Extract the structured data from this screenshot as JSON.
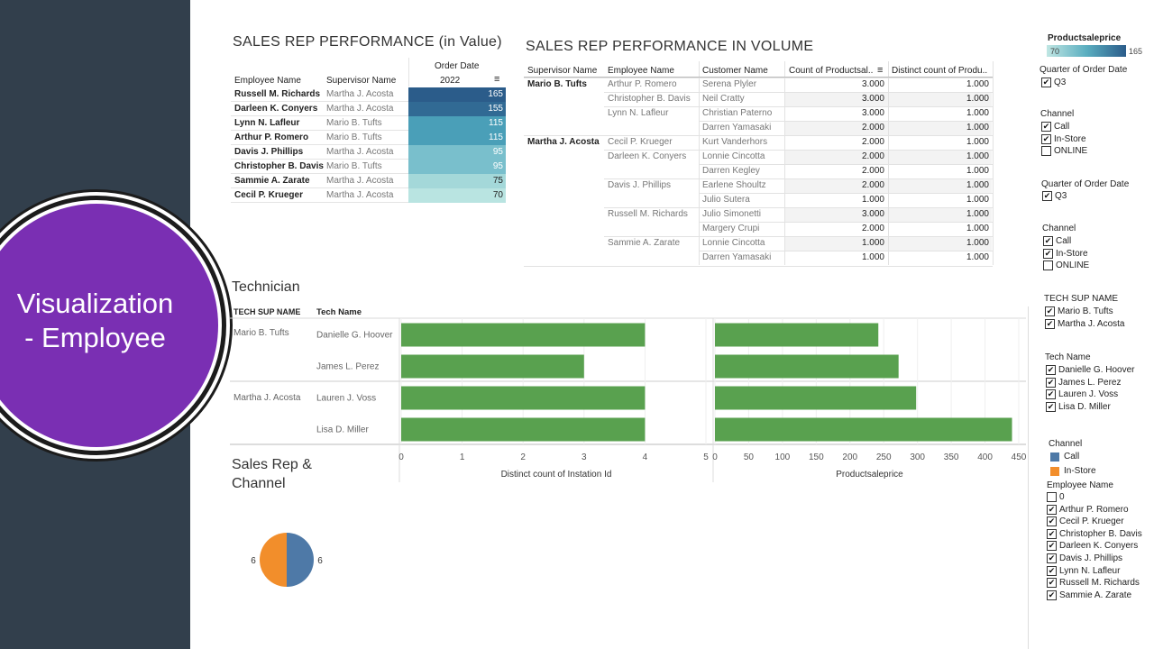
{
  "slide_title": "Visualization\n- Employee",
  "rep_value": {
    "title": "SALES REP PERFORMANCE (in Value)",
    "col_employee": "Employee Name",
    "col_supervisor": "Supervisor Name",
    "col_order_date": "Order Date",
    "col_year": "2022",
    "rows": [
      {
        "employee": "Russell M. Richards",
        "supervisor": "Martha J. Acosta",
        "value": "165",
        "color": "#2b5c8a",
        "text_color": "#ffffff"
      },
      {
        "employee": "Darleen K. Conyers",
        "supervisor": "Martha J. Acosta",
        "value": "155",
        "color": "#316a94",
        "text_color": "#ffffff"
      },
      {
        "employee": "Lynn N. Lafleur",
        "supervisor": "Mario B. Tufts",
        "value": "115",
        "color": "#4a9fb8",
        "text_color": "#ffffff"
      },
      {
        "employee": "Arthur P. Romero",
        "supervisor": "Mario B. Tufts",
        "value": "115",
        "color": "#4a9fb8",
        "text_color": "#ffffff"
      },
      {
        "employee": "Davis J. Phillips",
        "supervisor": "Martha J. Acosta",
        "value": "95",
        "color": "#79bfcc",
        "text_color": "#ffffff"
      },
      {
        "employee": "Christopher B. Davis",
        "supervisor": "Mario B. Tufts",
        "value": "95",
        "color": "#79bfcc",
        "text_color": "#ffffff"
      },
      {
        "employee": "Sammie A. Zarate",
        "supervisor": "Martha J. Acosta",
        "value": "75",
        "color": "#a4d8d9",
        "text_color": "#222222"
      },
      {
        "employee": "Cecil P. Krueger",
        "supervisor": "Martha J. Acosta",
        "value": "70",
        "color": "#b9e4e1",
        "text_color": "#222222"
      }
    ]
  },
  "rep_volume": {
    "title": "SALES REP PERFORMANCE IN VOLUME",
    "col_supervisor": "Supervisor Name",
    "col_employee": "Employee Name",
    "col_customer": "Customer Name",
    "col_count": "Count of Productsal..",
    "col_distinct": "Distinct count of Produ..",
    "rows": [
      {
        "supervisor": "Mario B. Tufts",
        "employee": "Arthur P. Romero",
        "customer": "Serena Plyler",
        "count": "3.000",
        "distinct": "1.000"
      },
      {
        "supervisor": "",
        "employee": "Christopher B. Davis",
        "customer": "Neil Cratty",
        "count": "3.000",
        "distinct": "1.000"
      },
      {
        "supervisor": "",
        "employee": "Lynn N. Lafleur",
        "customer": "Christian Paterno",
        "count": "3.000",
        "distinct": "1.000"
      },
      {
        "supervisor": "",
        "employee": "",
        "customer": "Darren Yamasaki",
        "count": "2.000",
        "distinct": "1.000"
      },
      {
        "supervisor": "Martha J. Acosta",
        "employee": "Cecil P. Krueger",
        "customer": "Kurt Vanderhors",
        "count": "2.000",
        "distinct": "1.000"
      },
      {
        "supervisor": "",
        "employee": "Darleen K. Conyers",
        "customer": "Lonnie Cincotta",
        "count": "2.000",
        "distinct": "1.000"
      },
      {
        "supervisor": "",
        "employee": "",
        "customer": "Darren Kegley",
        "count": "2.000",
        "distinct": "1.000"
      },
      {
        "supervisor": "",
        "employee": "Davis J. Phillips",
        "customer": "Earlene Shoultz",
        "count": "2.000",
        "distinct": "1.000"
      },
      {
        "supervisor": "",
        "employee": "",
        "customer": "Julio Sutera",
        "count": "1.000",
        "distinct": "1.000"
      },
      {
        "supervisor": "",
        "employee": "Russell M. Richards",
        "customer": "Julio Simonetti",
        "count": "3.000",
        "distinct": "1.000"
      },
      {
        "supervisor": "",
        "employee": "",
        "customer": "Margery Crupi",
        "count": "2.000",
        "distinct": "1.000"
      },
      {
        "supervisor": "",
        "employee": "Sammie A. Zarate",
        "customer": "Lonnie Cincotta",
        "count": "1.000",
        "distinct": "1.000"
      },
      {
        "supervisor": "",
        "employee": "",
        "customer": "Darren Yamasaki",
        "count": "1.000",
        "distinct": "1.000"
      }
    ]
  },
  "technician": {
    "title": "Technician",
    "col_sup": "TECH SUP NAME",
    "col_tech": "Tech Name",
    "sup_1": "Mario B. Tufts",
    "sup_2": "Martha J. Acosta"
  },
  "sales_channel": {
    "title_line1": "Sales Rep &",
    "title_line2": "Channel"
  },
  "chart_data": [
    {
      "type": "bar",
      "orientation": "horizontal",
      "categories": [
        "Danielle G. Hoover",
        "James L. Perez",
        "Lauren J. Voss",
        "Lisa D. Miller"
      ],
      "values": [
        4,
        3,
        4,
        4
      ],
      "xlabel": "Distinct count of Instation Id",
      "xlim": [
        0,
        5
      ],
      "ticks": [
        "0",
        "1",
        "2",
        "3",
        "4",
        "5"
      ],
      "color": "#59a14f",
      "grid": true
    },
    {
      "type": "bar",
      "orientation": "horizontal",
      "categories": [
        "Danielle G. Hoover",
        "James L. Perez",
        "Lauren J. Voss",
        "Lisa D. Miller"
      ],
      "values": [
        242,
        272,
        298,
        440
      ],
      "xlabel": "Productsaleprice",
      "xlim": [
        0,
        450
      ],
      "ticks": [
        "0",
        "50",
        "100",
        "150",
        "200",
        "250",
        "300",
        "350",
        "400",
        "450"
      ],
      "color": "#59a14f",
      "grid": true
    },
    {
      "type": "pie",
      "slices": [
        {
          "label": "Call",
          "value": 6,
          "value_label": "6",
          "color": "#4e79a7"
        },
        {
          "label": "In-Store",
          "value": 6,
          "value_label": "6",
          "color": "#f28e2b"
        }
      ]
    }
  ],
  "filters": {
    "legend_title": "Productsaleprice",
    "legend_min": "70",
    "legend_max": "165",
    "quarter1_title": "Quarter of Order Date",
    "quarter1_item": "Q3",
    "channel1_title": "Channel",
    "channel1_items": [
      "Call",
      "In-Store",
      "ONLINE"
    ],
    "quarter2_title": "Quarter of Order Date",
    "quarter2_item": "Q3",
    "channel2_title": "Channel",
    "channel2_items": [
      "Call",
      "In-Store",
      "ONLINE"
    ],
    "techsup_title": "TECH SUP NAME",
    "techsup_items": [
      "Mario B. Tufts",
      "Martha J. Acosta"
    ],
    "techname_title": "Tech Name",
    "techname_items": [
      "Danielle G. Hoover",
      "James L. Perez",
      "Lauren J. Voss",
      "Lisa D. Miller"
    ],
    "channel_legend_title": "Channel",
    "channel_legend_items": [
      "Call",
      "In-Store"
    ],
    "employee_title": "Employee Name",
    "employee_items": [
      "0",
      "Arthur P. Romero",
      "Cecil P. Krueger",
      "Christopher B. Davis",
      "Darleen K. Conyers",
      "Davis J. Phillips",
      "Lynn N. Lafleur",
      "Russell M. Richards",
      "Sammie A. Zarate"
    ]
  }
}
